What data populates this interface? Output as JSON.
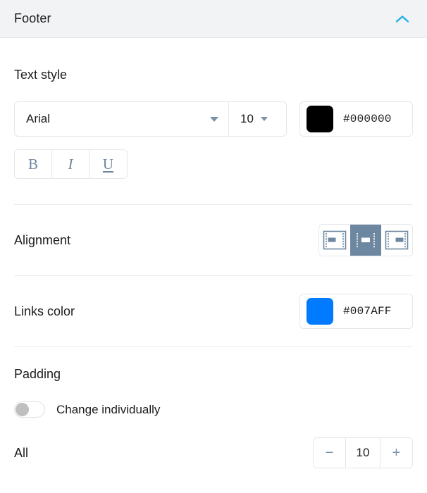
{
  "header": {
    "title": "Footer",
    "collapse_icon": "chevron-up-icon",
    "accent_color": "#22AEE8",
    "background": "#F1F3F5"
  },
  "text_style": {
    "label": "Text style",
    "font": {
      "value": "Arial",
      "caret_icon": "chevron-down-icon"
    },
    "size": {
      "value": "10",
      "caret_icon": "chevron-down-icon"
    },
    "color": {
      "value": "#000000",
      "swatch": "#000000"
    },
    "format_buttons": [
      {
        "name": "bold",
        "label": "B"
      },
      {
        "name": "italic",
        "label": "I"
      },
      {
        "name": "underline",
        "label": "U"
      }
    ]
  },
  "alignment": {
    "label": "Alignment",
    "options": [
      {
        "name": "align-left",
        "selected": false
      },
      {
        "name": "align-center",
        "selected": true
      },
      {
        "name": "align-right",
        "selected": false
      }
    ],
    "selected_color": "#6E87A0"
  },
  "links_color": {
    "label": "Links color",
    "value": "#007AFF",
    "swatch": "#007AFF"
  },
  "padding": {
    "label": "Padding",
    "toggle": {
      "label": "Change individually",
      "on": false
    },
    "all": {
      "label": "All",
      "value": "10",
      "decrement_label": "−",
      "increment_label": "+"
    }
  }
}
